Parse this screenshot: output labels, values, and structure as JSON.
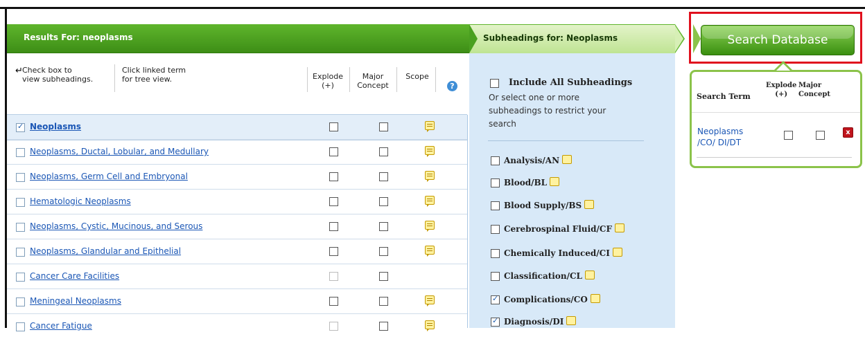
{
  "results": {
    "header": "Results For: neoplasms",
    "hint_check": "Check box to view subheadings.",
    "hint_check_line1": "Check box to",
    "hint_check_line2": "view subheadings.",
    "hint_click_line1": "Click linked term",
    "hint_click_line2": "for tree view.",
    "col_explode_line1": "Explode",
    "col_explode_line2": "(+)",
    "col_major_line1": "Major",
    "col_major_line2": "Concept",
    "col_scope": "Scope",
    "help_glyph": "?",
    "rows": [
      {
        "term": "Neoplasms",
        "checked": true,
        "selected": true,
        "scope": true
      },
      {
        "term": "Neoplasms, Ductal, Lobular, and Medullary",
        "checked": false,
        "scope": true
      },
      {
        "term": "Neoplasms, Germ Cell and Embryonal",
        "checked": false,
        "scope": true
      },
      {
        "term": "Hematologic Neoplasms",
        "checked": false,
        "scope": true
      },
      {
        "term": "Neoplasms, Cystic, Mucinous, and Serous",
        "checked": false,
        "scope": true
      },
      {
        "term": "Neoplasms, Glandular and Epithelial",
        "checked": false,
        "scope": true
      },
      {
        "term": "Cancer Care Facilities",
        "checked": false,
        "scope": false,
        "explode_disabled": true
      },
      {
        "term": "Meningeal Neoplasms",
        "checked": false,
        "scope": true
      },
      {
        "term": "Cancer Fatigue",
        "checked": false,
        "scope": true,
        "explode_disabled": true
      }
    ]
  },
  "subheadings": {
    "header": "Subheadings for: Neoplasms",
    "include_all": "Include All Subheadings",
    "include_desc": "Or select one or more subheadings to restrict your search",
    "items": [
      {
        "label": "Analysis/AN",
        "checked": false
      },
      {
        "label": "Blood/BL",
        "checked": false
      },
      {
        "label": "Blood Supply/BS",
        "checked": false
      },
      {
        "label": "Cerebrospinal Fluid/CF",
        "checked": false
      },
      {
        "label": "Chemically Induced/CI",
        "checked": false
      },
      {
        "label": "Classification/CL",
        "checked": false
      },
      {
        "label": "Complications/CO",
        "checked": true
      },
      {
        "label": "Diagnosis/DI",
        "checked": true
      }
    ]
  },
  "search_db": {
    "button_label": "Search Database"
  },
  "search_box": {
    "col_term": "Search Term",
    "col_explode_line1": "Explode",
    "col_explode_line2": "(+)",
    "col_major_line1": "Major",
    "col_major_line2": "Concept",
    "term": "Neoplasms /CO/ DI/DT",
    "remove_glyph": "x"
  },
  "colors": {
    "header_green": "#4aa020",
    "link_blue": "#1a56b5",
    "highlight_red": "#e0101d",
    "panel_blue": "#d8e9f8"
  }
}
